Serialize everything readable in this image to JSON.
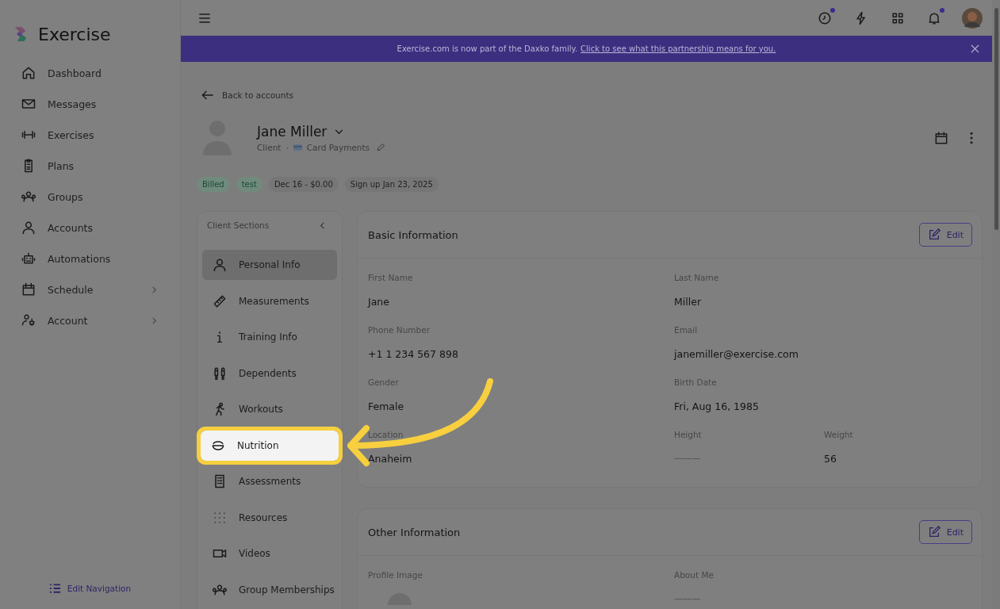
{
  "brand": {
    "name": "Exercise"
  },
  "nav": [
    {
      "label": "Dashboard",
      "selected": false,
      "submenu": false
    },
    {
      "label": "Messages",
      "selected": false,
      "submenu": false
    },
    {
      "label": "Exercises",
      "selected": false,
      "submenu": false
    },
    {
      "label": "Plans",
      "selected": false,
      "submenu": false
    },
    {
      "label": "Groups",
      "selected": false,
      "submenu": false
    },
    {
      "label": "Accounts",
      "selected": false,
      "submenu": false
    },
    {
      "label": "Automations",
      "selected": false,
      "submenu": false
    },
    {
      "label": "Schedule",
      "selected": false,
      "submenu": true
    },
    {
      "label": "Account",
      "selected": false,
      "submenu": true
    }
  ],
  "edit_navigation": "Edit Navigation",
  "topbar": {
    "notifications": [
      {
        "badge": true
      },
      {
        "badge": false
      },
      {
        "badge": false
      },
      {
        "badge": true
      }
    ]
  },
  "banner": {
    "text": "Exercise.com is now part of the Daxko family.",
    "link": "Click to see what this partnership means for you."
  },
  "back_link": "Back to accounts",
  "profile": {
    "name": "Jane Miller",
    "role": "Client",
    "separator": "·",
    "payment": "Card Payments"
  },
  "tags": [
    {
      "label": "Billed",
      "kind": "green"
    },
    {
      "label": "test",
      "kind": "green"
    },
    {
      "label": "Dec 16 - $0.00",
      "kind": "grey"
    },
    {
      "label": "Sign up Jan 23, 2025",
      "kind": "grey"
    }
  ],
  "client_sections": {
    "title": "Client Sections",
    "items": [
      {
        "label": "Personal Info",
        "selected": true,
        "highlighted": false
      },
      {
        "label": "Measurements",
        "selected": false,
        "highlighted": false
      },
      {
        "label": "Training Info",
        "selected": false,
        "highlighted": false
      },
      {
        "label": "Dependents",
        "selected": false,
        "highlighted": false
      },
      {
        "label": "Workouts",
        "selected": false,
        "highlighted": false
      },
      {
        "label": "Nutrition",
        "selected": false,
        "highlighted": true
      },
      {
        "label": "Assessments",
        "selected": false,
        "highlighted": false
      },
      {
        "label": "Resources",
        "selected": false,
        "highlighted": false
      },
      {
        "label": "Videos",
        "selected": false,
        "highlighted": false
      },
      {
        "label": "Group Memberships",
        "selected": false,
        "highlighted": false
      }
    ]
  },
  "cards": [
    {
      "title": "Basic Information",
      "button": "Edit",
      "rows": [
        [
          {
            "label": "First Name",
            "value": "Jane"
          },
          {
            "label": "Last Name",
            "value": "Miller"
          }
        ],
        [
          {
            "label": "Phone Number",
            "value": "+1 1 234 567 898"
          },
          {
            "label": "Email",
            "value": "janemiller@exercise.com"
          }
        ],
        [
          {
            "label": "Gender",
            "value": "Female"
          },
          {
            "label": "Birth Date",
            "value": "Fri, Aug 16, 1985"
          }
        ],
        [
          {
            "label": "Location",
            "value": "Anaheim"
          },
          {
            "label": "Height",
            "value": "———",
            "empty": true
          },
          {
            "label": "Weight",
            "value": "56"
          }
        ]
      ]
    },
    {
      "title": "Other Information",
      "button": "Edit",
      "rows": [
        [
          {
            "label": "Profile Image",
            "kind": "image"
          },
          {
            "label": "About Me",
            "value": "———",
            "empty": true
          }
        ]
      ]
    }
  ]
}
